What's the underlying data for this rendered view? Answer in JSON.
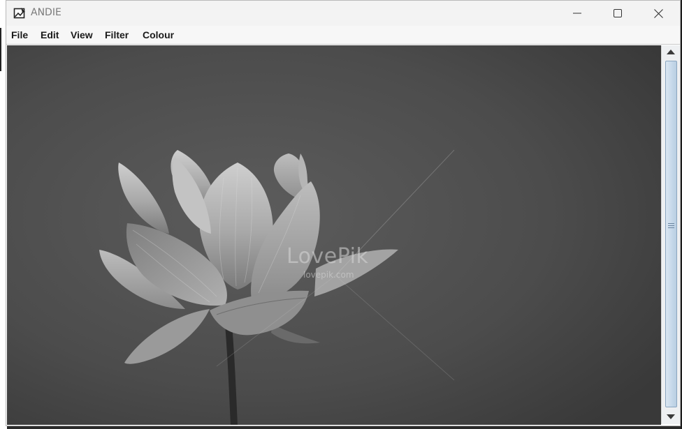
{
  "window": {
    "title": "ANDIE",
    "controls": {
      "minimize": "minimize",
      "maximize": "maximize",
      "close": "close"
    }
  },
  "menu": {
    "items": [
      {
        "label": "File"
      },
      {
        "label": "Edit"
      },
      {
        "label": "View"
      },
      {
        "label": "Filter"
      },
      {
        "label": "Colour"
      }
    ]
  },
  "image": {
    "subject": "grayscale lotus flower",
    "watermark": {
      "brand": "LovePik",
      "url": "lovepik.com"
    }
  },
  "scrollbar": {
    "orientation": "vertical",
    "position": 0
  },
  "colors": {
    "titlebar": "#f3f3f3",
    "menubar": "#f7f7f7",
    "scroll_thumb": "#c7d9ea",
    "image_background": "#505050"
  }
}
